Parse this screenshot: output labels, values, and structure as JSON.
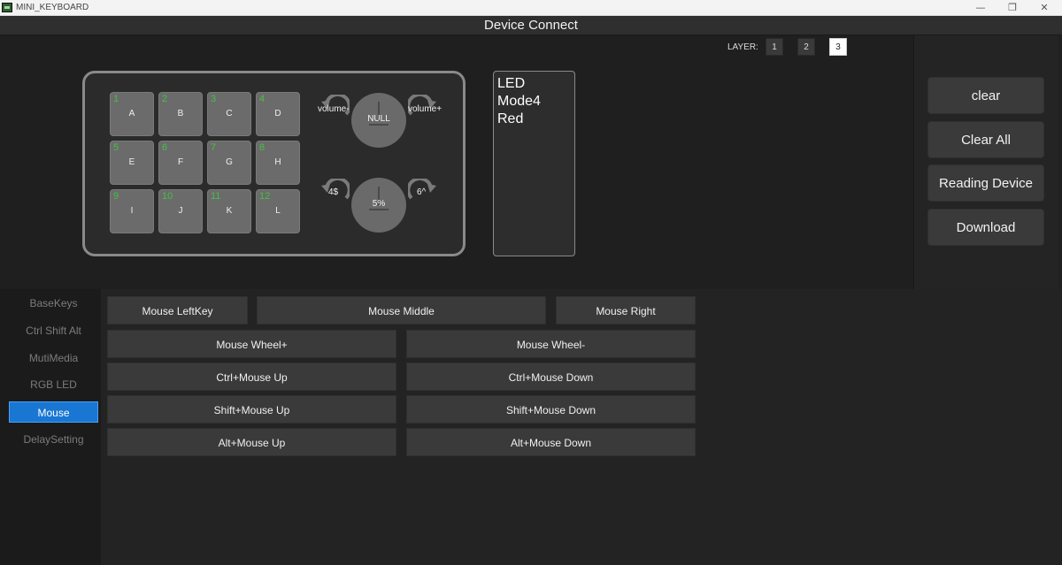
{
  "window": {
    "title": "MINI_KEYBOARD",
    "controls": {
      "minimize": "—",
      "maximize": "❐",
      "close": "✕"
    }
  },
  "header": {
    "title": "Device Connect"
  },
  "layer": {
    "label": "LAYER:",
    "buttons": [
      "1",
      "2",
      "3"
    ],
    "active": "3"
  },
  "keys": [
    {
      "num": "1",
      "label": "A"
    },
    {
      "num": "2",
      "label": "B"
    },
    {
      "num": "3",
      "label": "C"
    },
    {
      "num": "4",
      "label": "D"
    },
    {
      "num": "5",
      "label": "E"
    },
    {
      "num": "6",
      "label": "F"
    },
    {
      "num": "7",
      "label": "G"
    },
    {
      "num": "8",
      "label": "H"
    },
    {
      "num": "9",
      "label": "I"
    },
    {
      "num": "10",
      "label": "J"
    },
    {
      "num": "11",
      "label": "K"
    },
    {
      "num": "12",
      "label": "L"
    }
  ],
  "knobs": [
    {
      "left": "volume-",
      "press": "NULL",
      "right": "volume+"
    },
    {
      "left": "4$",
      "press": "5%",
      "right": "6^"
    }
  ],
  "led": {
    "lines": [
      "LED",
      "Mode4",
      "Red"
    ]
  },
  "actions": {
    "clear": "clear",
    "clear_all": "Clear All",
    "reading_device": "Reading Device",
    "download": "Download"
  },
  "nav": {
    "items": [
      "BaseKeys",
      "Ctrl Shift Alt",
      "MutiMedia",
      "RGB LED",
      "Mouse",
      "DelaySetting"
    ],
    "active": "Mouse"
  },
  "mouse_buttons": {
    "left_key": "Mouse LeftKey",
    "middle": "Mouse Middle",
    "right": "Mouse Right",
    "wheel_up": "Mouse Wheel+",
    "wheel_down": "Mouse Wheel-",
    "ctrl_up": "Ctrl+Mouse Up",
    "ctrl_down": "Ctrl+Mouse Down",
    "shift_up": "Shift+Mouse Up",
    "shift_down": "Shift+Mouse Down",
    "alt_up": "Alt+Mouse Up",
    "alt_down": "Alt+Mouse Down"
  },
  "colors": {
    "accent": "#1976d2",
    "key_number": "#44c044",
    "key_face": "#6b6b6b",
    "button": "#3a3a3a"
  }
}
